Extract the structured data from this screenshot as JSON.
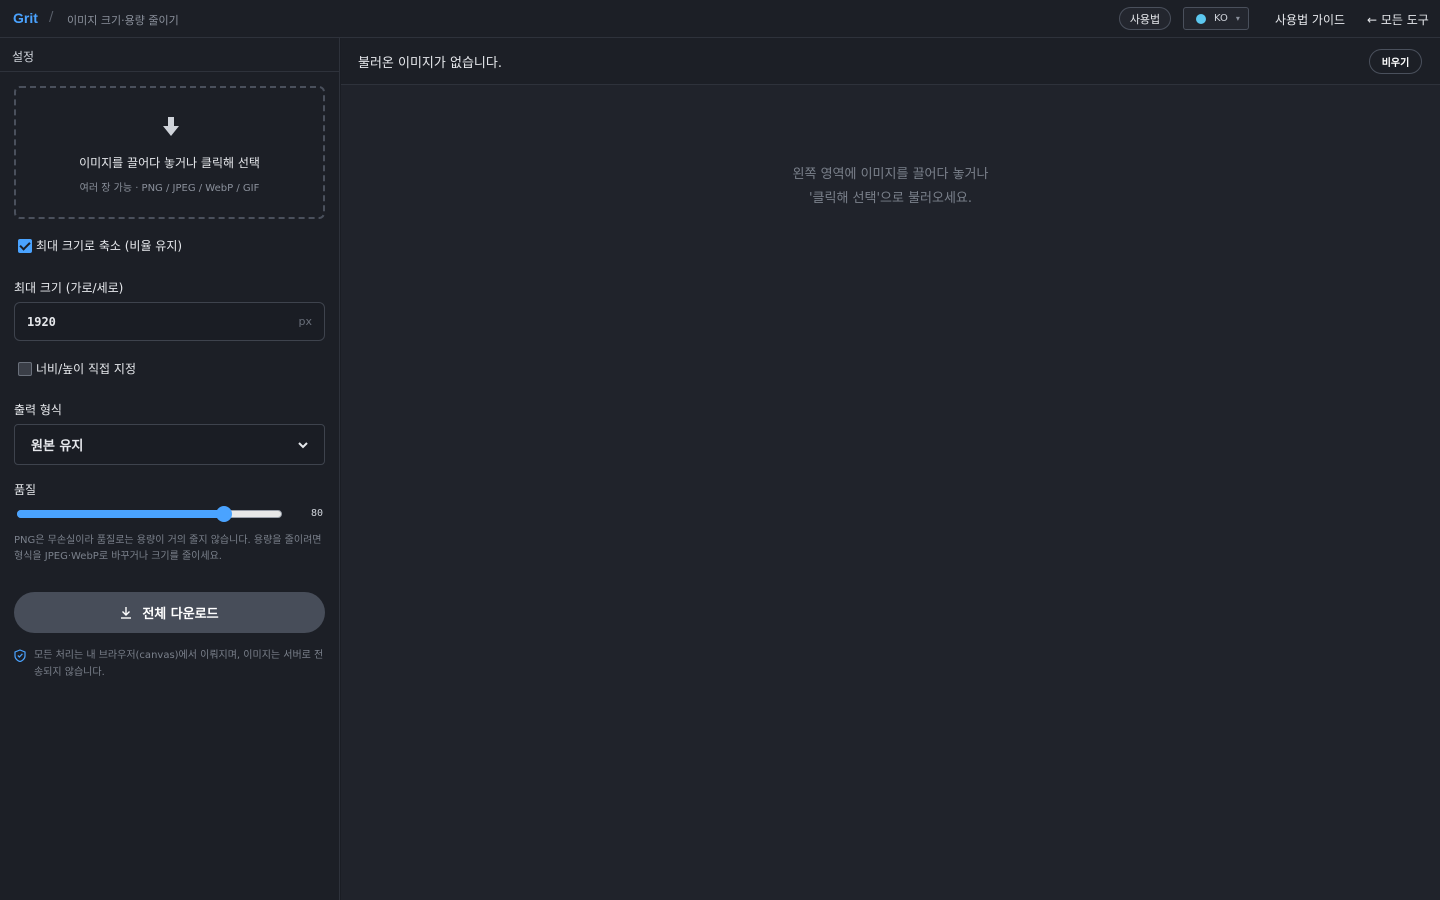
{
  "header": {
    "brand": "Grit",
    "separator": "/",
    "page_title": "이미지 크기·용량 줄이기",
    "usage_button": "사용법",
    "language": "KO",
    "guide_link": "사용법 가이드",
    "all_tools": "← 모든 도구"
  },
  "sidebar": {
    "title": "설정",
    "dropzone": {
      "main_text": "이미지를 끌어다 놓거나 클릭해 선택",
      "sub_text": "여러 장 가능 · PNG / JPEG / WebP / GIF"
    },
    "max_size_checkbox": {
      "label": "최대 크기로 축소 (비율 유지)",
      "checked": true
    },
    "max_size_label": "최대 크기 (가로/세로)",
    "max_size_value": "1920",
    "max_size_unit": "px",
    "custom_dims_checkbox": {
      "label": "너비/높이 직접 지정",
      "checked": false
    },
    "format_label": "출력 형식",
    "format_value": "원본 유지",
    "quality_label": "품질",
    "quality_value": "80",
    "quality_level": 0.78,
    "hint": "PNG은 무손실이라 품질로는 용량이 거의 줄지 않습니다. 용량을 줄이려면 형식을 JPEG·WebP로 바꾸거나 크기를 줄이세요.",
    "download_button": "전체 다운로드",
    "privacy_note": "모든 처리는 내 브라우저(canvas)에서 이뤄지며, 이미지는 서버로 전송되지 않습니다."
  },
  "main": {
    "status": "불러온 이미지가 없습니다.",
    "clear_button": "비우기",
    "empty_line1": "왼쪽 영역에 이미지를 끌어다 놓거나",
    "empty_line2": "'클릭해 선택'으로 불러오세요."
  },
  "colors": {
    "accent": "#4aa3ff",
    "background": "#1a1d24",
    "panel": "#1c1f26"
  }
}
